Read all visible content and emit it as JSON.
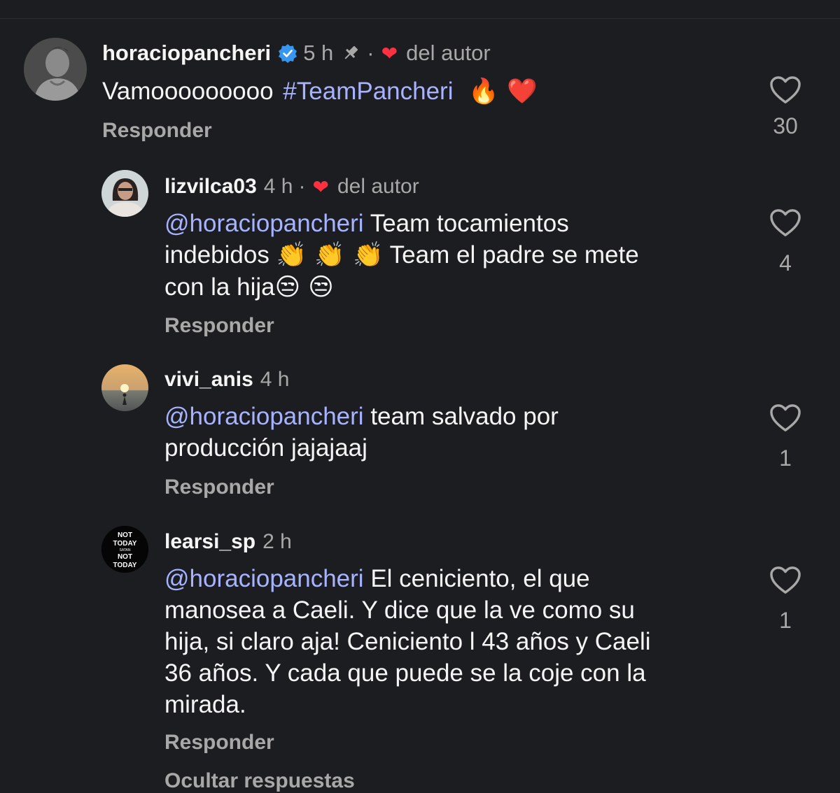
{
  "comments": [
    {
      "username": "horaciopancheri",
      "verified": true,
      "time": "5 h",
      "pinned": true,
      "liked_by_author": true,
      "author_like_label": "del autor",
      "text": "Vamooooooooo",
      "hashtag": "#TeamPancheri",
      "emojis": "🔥 ❤️",
      "reply_label": "Responder",
      "like_count": "30"
    },
    {
      "username": "lizvilca03",
      "time": "4 h",
      "liked_by_author": true,
      "author_like_label": "del autor",
      "mention": "@horaciopancheri",
      "lines": [
        "Team tocamientos",
        "indebidos",
        "Team el padre se mete",
        "con la hija"
      ],
      "emojis_clap": "👏 👏 👏",
      "emojis_face": "😒 😒",
      "reply_label": "Responder",
      "like_count": "4"
    },
    {
      "username": "vivi_anis",
      "time": "4 h",
      "mention": "@horaciopancheri",
      "lines": [
        "team salvado por",
        "producción jajajaaj"
      ],
      "reply_label": "Responder",
      "like_count": "1"
    },
    {
      "username": "learsi_sp",
      "time": "2 h",
      "mention": "@horaciopancheri",
      "lines": [
        "El ceniciento, el que",
        "manosea a Caeli. Y dice que la ve como su",
        "hija, si claro aja! Ceniciento l 43 años y Caeli",
        "36 años. Y cada que puede se la coje con la",
        "mirada."
      ],
      "avatar_text": [
        "NOT",
        "TODAY",
        "SATAN",
        "NOT",
        "TODAY"
      ],
      "reply_label": "Responder",
      "like_count": "1"
    }
  ],
  "hide_replies_label": "Ocultar respuestas",
  "colors": {
    "background": "#1c1d20",
    "mention": "#a8b3ff",
    "verified": "#3797f0",
    "heart": "#ff3040",
    "meta": "#a8a8a8"
  }
}
